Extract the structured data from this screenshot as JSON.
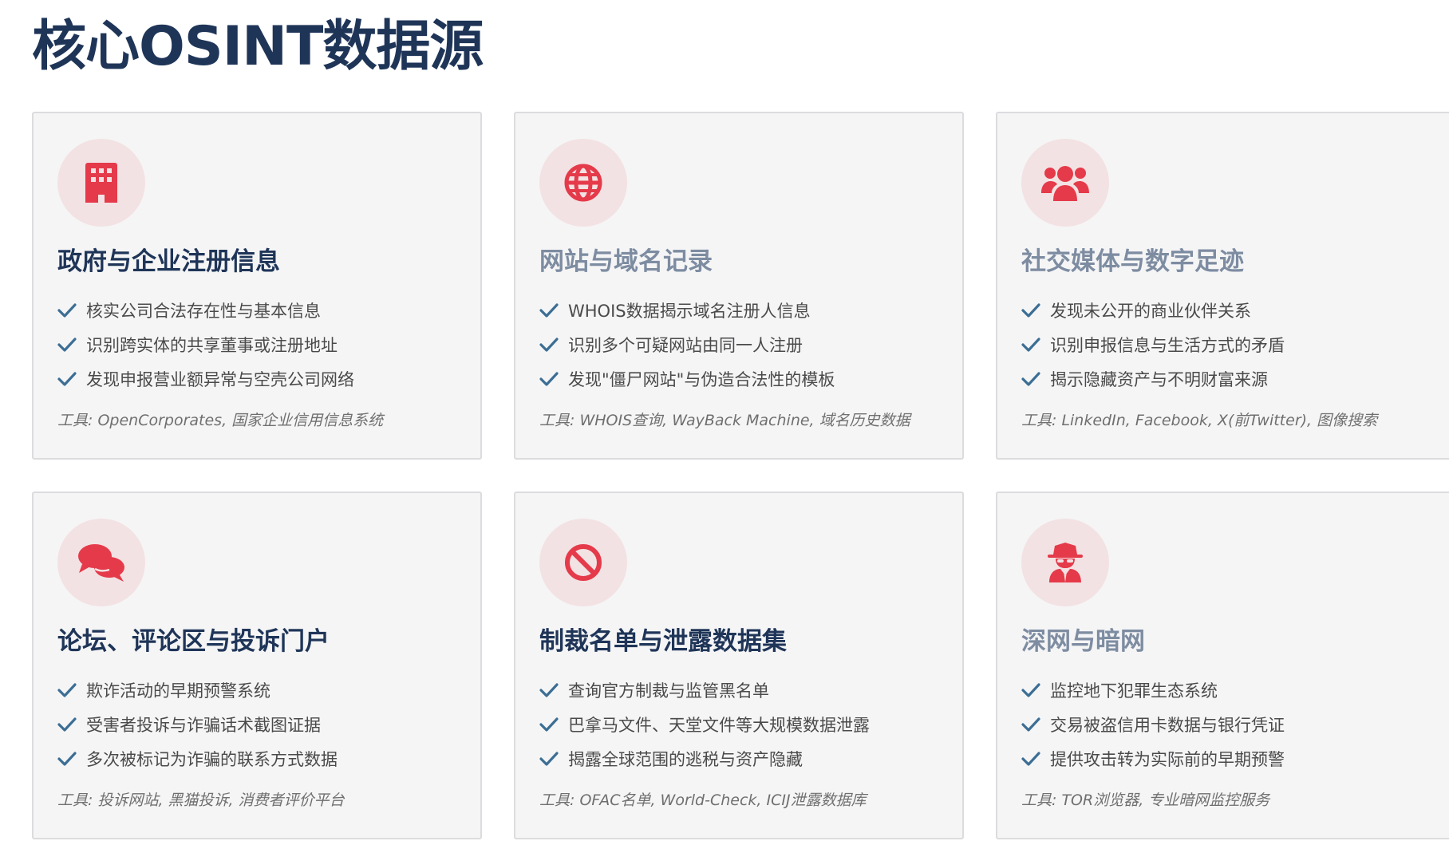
{
  "page": {
    "title": "核心OSINT数据源"
  },
  "colors": {
    "title": "#1f3558",
    "muted_title": "#7d8ca1",
    "icon_accent": "#e53a4a",
    "icon_bg": "#f3e2e3",
    "check": "#3c6e94",
    "card_bg": "#f5f5f6"
  },
  "cards": [
    {
      "icon": "building-icon",
      "title": "政府与企业注册信息",
      "features": [
        "核实公司合法存在性与基本信息",
        "识别跨实体的共享董事或注册地址",
        "发现申报营业额异常与空壳公司网络"
      ],
      "tools": "工具: OpenCorporates, 国家企业信用信息系统"
    },
    {
      "icon": "globe-icon",
      "title": "网站与域名记录",
      "features": [
        "WHOIS数据揭示域名注册人信息",
        "识别多个可疑网站由同一人注册",
        "发现\"僵尸网站\"与伪造合法性的模板"
      ],
      "tools": "工具: WHOIS查询, WayBack Machine, 域名历史数据"
    },
    {
      "icon": "users-icon",
      "title": "社交媒体与数字足迹",
      "features": [
        "发现未公开的商业伙伴关系",
        "识别申报信息与生活方式的矛盾",
        "揭示隐藏资产与不明财富来源"
      ],
      "tools": "工具: LinkedIn, Facebook, X(前Twitter), 图像搜索"
    },
    {
      "icon": "comments-icon",
      "title": "论坛、评论区与投诉门户",
      "features": [
        "欺诈活动的早期预警系统",
        "受害者投诉与诈骗话术截图证据",
        "多次被标记为诈骗的联系方式数据"
      ],
      "tools": "工具: 投诉网站, 黑猫投诉, 消费者评价平台"
    },
    {
      "icon": "ban-icon",
      "title": "制裁名单与泄露数据集",
      "features": [
        "查询官方制裁与监管黑名单",
        "巴拿马文件、天堂文件等大规模数据泄露",
        "揭露全球范围的逃税与资产隐藏"
      ],
      "tools": "工具: OFAC名单, World-Check, ICIJ泄露数据库"
    },
    {
      "icon": "spy-icon",
      "title": "深网与暗网",
      "features": [
        "监控地下犯罪生态系统",
        "交易被盗信用卡数据与银行凭证",
        "提供攻击转为实际前的早期预警"
      ],
      "tools": "工具: TOR浏览器, 专业暗网监控服务"
    }
  ]
}
